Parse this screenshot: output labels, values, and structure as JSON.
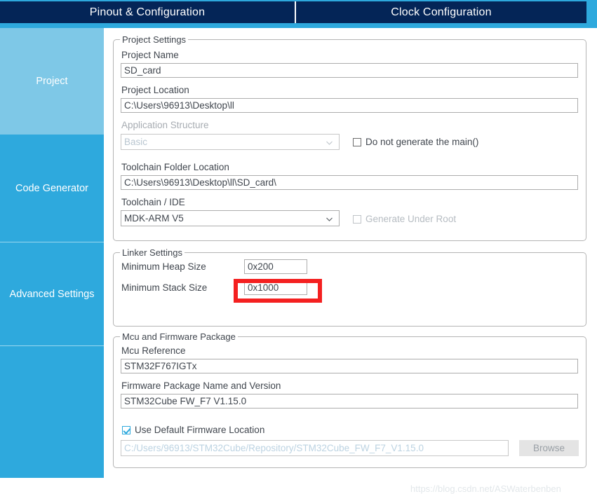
{
  "tabs": [
    {
      "label": "Pinout & Configuration",
      "active": true
    },
    {
      "label": "Clock Configuration",
      "active": false
    }
  ],
  "sidebar": {
    "items": [
      {
        "label": "Project",
        "selected": true
      },
      {
        "label": "Code Generator",
        "selected": false
      },
      {
        "label": "Advanced Settings",
        "selected": false
      },
      {
        "label": "",
        "selected": false
      }
    ]
  },
  "project_settings": {
    "group_title": "Project Settings",
    "project_name_label": "Project Name",
    "project_name_value": "SD_card",
    "project_location_label": "Project Location",
    "project_location_value": "C:\\Users\\96913\\Desktop\\ll",
    "application_structure_label": "Application Structure",
    "application_structure_value": "Basic",
    "do_not_generate_main_label": "Do not generate the main()",
    "toolchain_folder_label": "Toolchain Folder Location",
    "toolchain_folder_value": "C:\\Users\\96913\\Desktop\\ll\\SD_card\\",
    "toolchain_ide_label": "Toolchain / IDE",
    "toolchain_ide_value": "MDK-ARM V5",
    "generate_under_root_label": "Generate Under Root"
  },
  "linker_settings": {
    "group_title": "Linker Settings",
    "min_heap_label": "Minimum Heap Size",
    "min_heap_value": "0x200",
    "min_stack_label": "Minimum Stack Size",
    "min_stack_value": "0x1000"
  },
  "mcu_firmware": {
    "group_title": "Mcu and Firmware Package",
    "mcu_reference_label": "Mcu Reference",
    "mcu_reference_value": "STM32F767IGTx",
    "firmware_package_label": "Firmware Package Name and Version",
    "firmware_package_value": "STM32Cube FW_F7 V1.15.0",
    "use_default_firmware_label": "Use Default Firmware Location",
    "firmware_path_value": "C:/Users/96913/STM32Cube/Repository/STM32Cube_FW_F7_V1.15.0",
    "browse_label": "Browse"
  },
  "watermark": "https://blog.csdn.net/ASWaterbenben",
  "colors": {
    "tab_active_bg": "#042557",
    "accent": "#2ea9dd",
    "sidebar_selected": "#7ec8e7",
    "annotation_red": "#f42020",
    "text": "#40464e"
  }
}
